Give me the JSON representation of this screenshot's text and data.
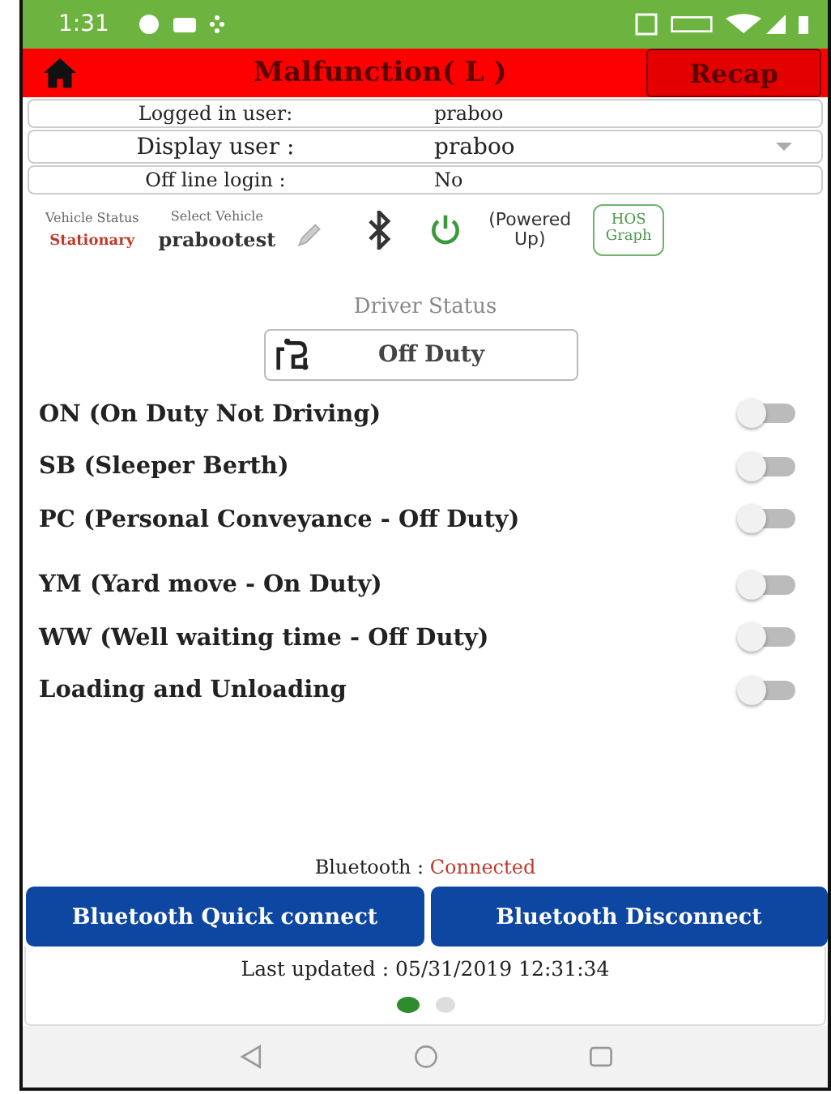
{
  "status_bar": {
    "time": "1:31"
  },
  "header": {
    "title": "Malfunction( L )",
    "recap_button": "Recap"
  },
  "info_rows": [
    {
      "label": "Logged in user:",
      "value": "praboo",
      "kind": "text"
    },
    {
      "label": "Display user :",
      "value": "praboo",
      "kind": "dropdown"
    },
    {
      "label": "Off line login :",
      "value": "No",
      "kind": "text"
    }
  ],
  "vehicle": {
    "status_label": "Vehicle Status",
    "status_value": "Stationary",
    "select_label": "Select Vehicle",
    "select_value": "prabootest",
    "power_text": "(Powered Up)",
    "hos_button": "HOS Graph"
  },
  "driver_status": {
    "title": "Driver Status",
    "current": "Off Duty"
  },
  "toggles": [
    {
      "label": "ON (On Duty Not Driving)",
      "on": false
    },
    {
      "label": "SB (Sleeper Berth)",
      "on": false
    },
    {
      "label": "PC (Personal Conveyance - Off Duty)",
      "on": false
    },
    {
      "label": "YM (Yard move - On Duty)",
      "on": false
    },
    {
      "label": "WW (Well waiting time - Off Duty)",
      "on": false
    },
    {
      "label": "Loading and Unloading",
      "on": false
    }
  ],
  "bluetooth": {
    "label": "Bluetooth :",
    "state": "Connected"
  },
  "buttons": [
    "Bluetooth Quick connect",
    "Bluetooth Disconnect"
  ],
  "last_updated": "Last updated : 05/31/2019 12:31:34",
  "pages": [
    {
      "selected": true
    },
    {
      "selected": false
    }
  ]
}
